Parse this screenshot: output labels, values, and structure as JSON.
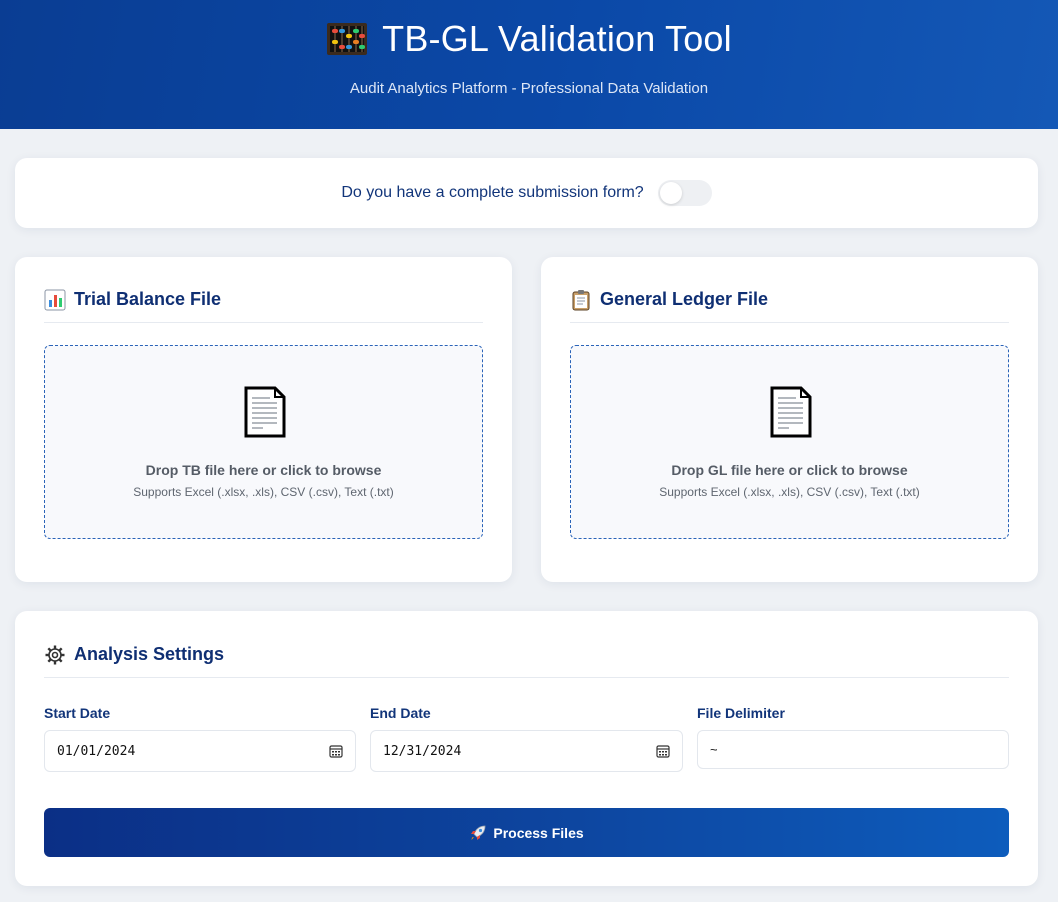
{
  "header": {
    "icon": "abacus-icon",
    "title": "TB-GL Validation Tool",
    "subtitle": "Audit Analytics Platform - Professional Data Validation"
  },
  "submission_toggle": {
    "label": "Do you have a complete submission form?",
    "checked": false
  },
  "tb_card": {
    "icon": "bar-chart-icon",
    "title": "Trial Balance File",
    "drop_main": "Drop TB file here or click to browse",
    "drop_sub": "Supports Excel (.xlsx, .xls), CSV (.csv), Text (.txt)"
  },
  "gl_card": {
    "icon": "clipboard-icon",
    "title": "General Ledger File",
    "drop_main": "Drop GL file here or click to browse",
    "drop_sub": "Supports Excel (.xlsx, .xls), CSV (.csv), Text (.txt)"
  },
  "settings": {
    "icon": "gear-icon",
    "title": "Analysis Settings",
    "start_date_label": "Start Date",
    "start_date_value": "01/01/2024",
    "end_date_label": "End Date",
    "end_date_value": "12/31/2024",
    "delimiter_label": "File Delimiter",
    "delimiter_value": "~",
    "process_label": "Process Files"
  },
  "colors": {
    "header_bg": "#0b49a8",
    "accent": "#0f2f73",
    "dropzone_border": "#2a63b8",
    "button_bg": "#0d46a0"
  }
}
